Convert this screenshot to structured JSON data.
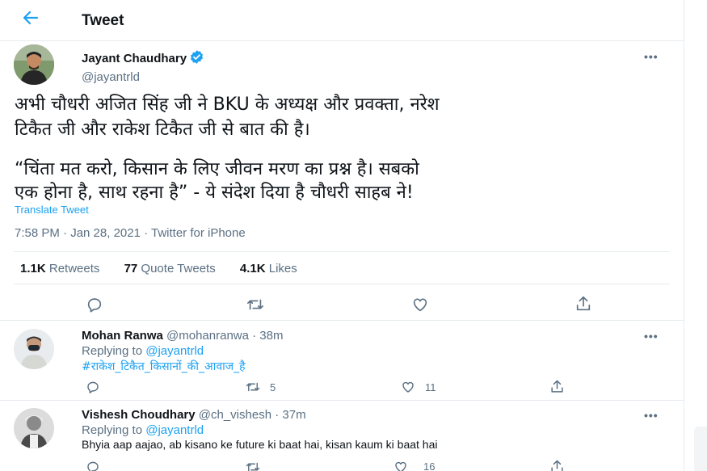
{
  "header": {
    "back_icon": "arrow-left-icon",
    "title": "Tweet"
  },
  "tweet": {
    "author_name": "Jayant Chaudhary",
    "author_handle": "@jayantrld",
    "verified": true,
    "text_lines": [
      "अभी चौधरी अजित सिंह जी ने BKU के अध्यक्ष और प्रवक्ता, नरेश",
      "टिकैत जी और राकेश टिकैत जी से बात की है।",
      "“चिंता मत करो, किसान के लिए जीवन मरण का प्रश्न है। सबको",
      "एक होना है, साथ रहना है” - ये संदेश दिया है चौधरी साहब ने!"
    ],
    "translate_label": "Translate Tweet",
    "timestamp": "7:58 PM · Jan 28, 2021 · Twitter for iPhone",
    "stats": {
      "retweets_count": "1.1K",
      "retweets_label": "Retweets",
      "quotes_count": "77",
      "quotes_label": "Quote Tweets",
      "likes_count": "4.1K",
      "likes_label": "Likes"
    }
  },
  "replies": [
    {
      "name": "Mohan Ranwa",
      "handle": "@mohanranwa",
      "time": "· 38m",
      "replying_prefix": "Replying to",
      "replying_to": "@jayantrld",
      "text": "#राकेश_टिकैत_किसानों_की_आवाज_है",
      "retweets": "5",
      "likes": "11"
    },
    {
      "name": "Vishesh Choudhary",
      "handle": "@ch_vishesh",
      "time": "· 37m",
      "replying_prefix": "Replying to",
      "replying_to": "@jayantrld",
      "text": "Bhyia aap aajao, ab kisano ke future ki baat hai, kisan kaum ki baat hai",
      "retweets": "",
      "likes": "16"
    }
  ],
  "colors": {
    "accent": "#1da1f2",
    "secondary_text": "#5b7083",
    "border": "#e6ecf0"
  }
}
